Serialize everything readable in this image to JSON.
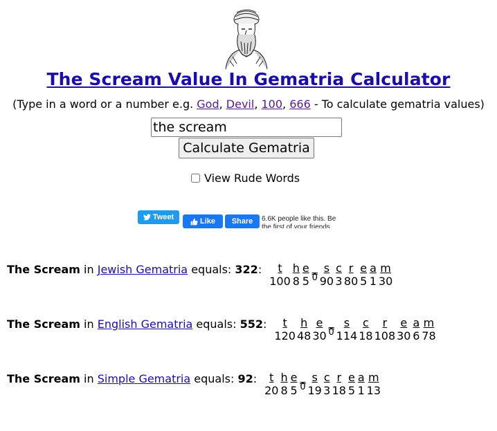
{
  "header": {
    "title": "The Scream Value In Gematria Calculator",
    "subtitle_prefix": "(Type in a word or a number e.g. ",
    "links": [
      "God",
      "Devil",
      "100",
      "666"
    ],
    "sep": ", ",
    "subtitle_suffix": " - To calculate gematria values)"
  },
  "search": {
    "value": "the scream"
  },
  "calc_button": {
    "label": "Calculate Gematria"
  },
  "rude_words": {
    "label": "View Rude Words",
    "checked": false
  },
  "social": {
    "tweet_label": "Tweet",
    "like_label": "Like",
    "share_label": "Share",
    "like_count_text": "6.6K people like this. Be the first of your friends."
  },
  "results": [
    {
      "phrase": "The Scream",
      "in": " in ",
      "cipher": "Jewish Gematria",
      "equals": " equals: ",
      "total": "322",
      "colon": ":",
      "letters": [
        {
          "ch": "t",
          "val": "100"
        },
        {
          "ch": "h",
          "val": "8"
        },
        {
          "ch": "e",
          "val": "5"
        },
        {
          "ch": "_",
          "val": "0",
          "space": true
        },
        {
          "ch": "s",
          "val": "90"
        },
        {
          "ch": "c",
          "val": "3"
        },
        {
          "ch": "r",
          "val": "80"
        },
        {
          "ch": "e",
          "val": "5"
        },
        {
          "ch": "a",
          "val": "1"
        },
        {
          "ch": "m",
          "val": "30"
        }
      ]
    },
    {
      "phrase": "The Scream",
      "in": " in ",
      "cipher": "English Gematria",
      "equals": " equals: ",
      "total": "552",
      "colon": ":",
      "letters": [
        {
          "ch": "t",
          "val": "120"
        },
        {
          "ch": "h",
          "val": "48"
        },
        {
          "ch": "e",
          "val": "30"
        },
        {
          "ch": "_",
          "val": "0",
          "space": true
        },
        {
          "ch": "s",
          "val": "114"
        },
        {
          "ch": "c",
          "val": "18"
        },
        {
          "ch": "r",
          "val": "108"
        },
        {
          "ch": "e",
          "val": "30"
        },
        {
          "ch": "a",
          "val": "6"
        },
        {
          "ch": "m",
          "val": "78"
        }
      ]
    },
    {
      "phrase": "The Scream",
      "in": " in ",
      "cipher": "Simple Gematria",
      "equals": " equals: ",
      "total": "92",
      "colon": ":",
      "letters": [
        {
          "ch": "t",
          "val": "20"
        },
        {
          "ch": "h",
          "val": "8"
        },
        {
          "ch": "e",
          "val": "5"
        },
        {
          "ch": "_",
          "val": "0",
          "space": true
        },
        {
          "ch": "s",
          "val": "19"
        },
        {
          "ch": "c",
          "val": "3"
        },
        {
          "ch": "r",
          "val": "18"
        },
        {
          "ch": "e",
          "val": "5"
        },
        {
          "ch": "a",
          "val": "1"
        },
        {
          "ch": "m",
          "val": "13"
        }
      ]
    }
  ]
}
